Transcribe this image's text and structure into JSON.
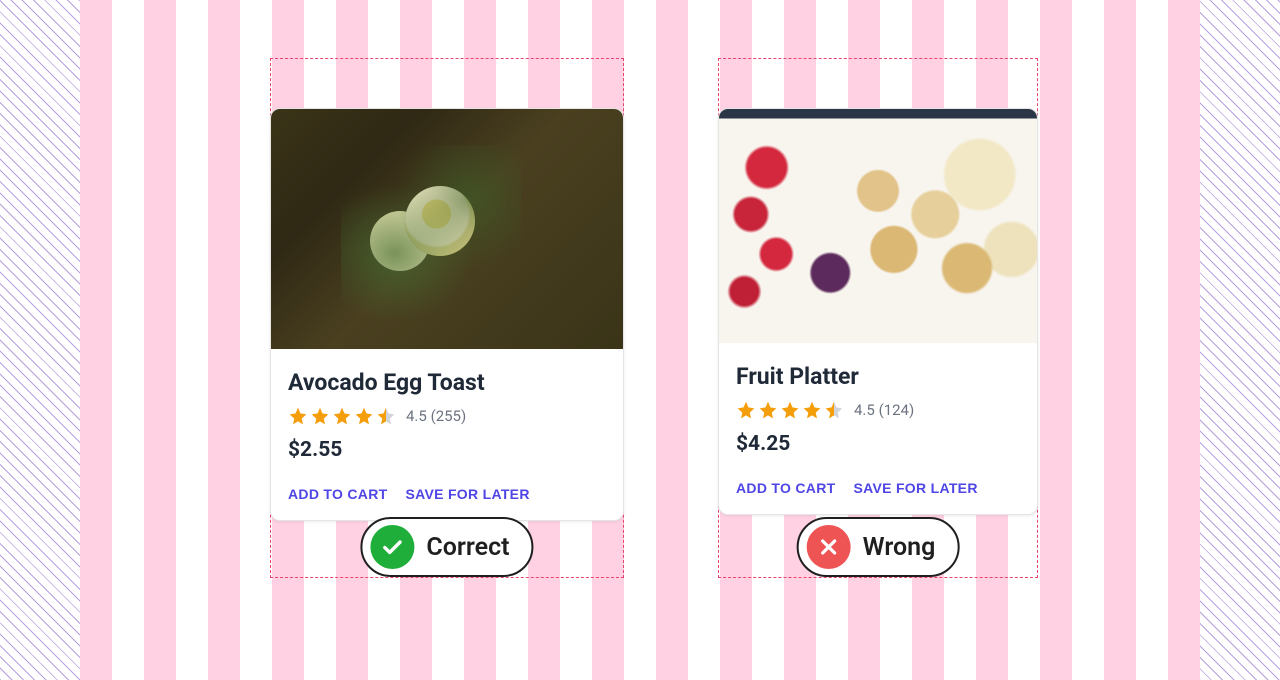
{
  "cards": [
    {
      "title": "Avocado Egg Toast",
      "rating": "4.5",
      "reviews": "(255)",
      "price": "$2.55",
      "add_label": "ADD TO CART",
      "save_label": "SAVE FOR LATER",
      "badge": "Correct"
    },
    {
      "title": "Fruit Platter",
      "rating": "4.5",
      "reviews": "(124)",
      "price": "$4.25",
      "add_label": "ADD TO CART",
      "save_label": "SAVE FOR LATER",
      "badge": "Wrong"
    }
  ]
}
